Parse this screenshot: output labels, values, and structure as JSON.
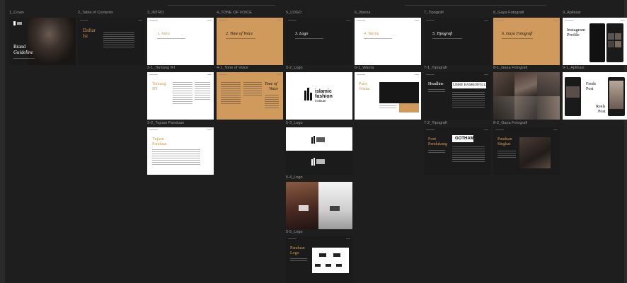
{
  "frames": {
    "cover": {
      "label": "1_Cover",
      "brand": "Brand",
      "guideline": "Guideline"
    },
    "toc": {
      "label": "2_Table of Contents",
      "title_line1": "Daftar",
      "title_line2": "Isi"
    },
    "intro": {
      "label": "3_INTRO",
      "title": "1. Intro"
    },
    "tone": {
      "label": "4_TONE OF VOICE",
      "title": "2. Tone of Voice"
    },
    "logo": {
      "label": "5_LOGO",
      "title": "3. Logo"
    },
    "warna": {
      "label": "6_Warna",
      "title": "4. Warna"
    },
    "tipografi": {
      "label": "7_Tipografi",
      "title": "5. Tipografi"
    },
    "gaya": {
      "label": "8_Gaya Fotografi",
      "title": "6. Gaya Fotografi"
    },
    "aplikasi": {
      "label": "9_Aplikasi",
      "title_line1": "Instagram",
      "title_line2": "Profile"
    },
    "tentang": {
      "label": "3-1_Tentang IFI",
      "title_line1": "Tentang",
      "title_line2": "IFI"
    },
    "tone1": {
      "label": "4-1_Tone of Voice",
      "title_line1": "Tone of",
      "title_line2": "Voice"
    },
    "logo2": {
      "label": "5-2_Logo",
      "brand_line1": "islamic",
      "brand_line2": "fashion",
      "brand_line3": "institute"
    },
    "warna1": {
      "label": "6-1_Warna",
      "title_line1": "Palet",
      "title_line2": "Warna"
    },
    "tipo1": {
      "label": "7-1_Tipografi",
      "headline": "Headline",
      "font_name": "LIBRE BASKERVILLE"
    },
    "gaya1": {
      "label": "8-1_Gaya Fotografi"
    },
    "aplikasi1": {
      "label": "9-1_Aplikasi",
      "feeds_line1": "Feeds",
      "feeds_line2": "Post",
      "reels_line1": "Reels",
      "reels_line2": "Post"
    },
    "tujuan": {
      "label": "3-2_Tujuan Panduan",
      "title_line1": "Tujuan",
      "title_line2": "Panduan"
    },
    "logo3": {
      "label": "5-3_Logo"
    },
    "tipo2": {
      "label": "7-2_Tipografi",
      "title_line1": "Font",
      "title_line2": "Pendukung",
      "font_name": "GOTHAM"
    },
    "gaya2": {
      "label": "8-2_Gaya Fotografi",
      "title_line1": "Panduan",
      "title_line2": "Singkat"
    },
    "logo4": {
      "label": "5-4_Logo"
    },
    "logo5": {
      "label": "5-5_Logo",
      "title_line1": "Panduan",
      "title_line2": "Logo"
    }
  },
  "colors": {
    "canvas": "#1e1e1e",
    "gold": "#d49a4e",
    "tan": "#cf9a5b",
    "slide_dark": "#1b1b1b"
  }
}
